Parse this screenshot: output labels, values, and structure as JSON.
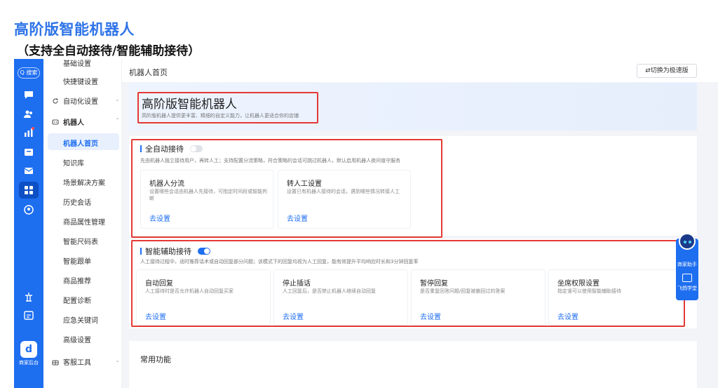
{
  "heading": {
    "main": "高阶版智能机器人",
    "sub": "（支持全自动接待/智能辅助接待）"
  },
  "rail": {
    "search": "Q 搜索",
    "brand_label": "商家后台",
    "brand_glyph": "d",
    "icons": [
      "chat-icon",
      "users-icon",
      "chart-icon",
      "box-icon",
      "mail-icon",
      "apps-icon",
      "user-icon",
      "settings-icon",
      "calendar-icon"
    ]
  },
  "menu": {
    "items_top": [
      "基础设置",
      "快捷键设置"
    ],
    "group_automation": "自动化设置",
    "group_robot": "机器人",
    "robot_items": [
      "机器人首页",
      "知识库",
      "场景解决方案",
      "历史会话",
      "商品属性管理",
      "智能尺码表",
      "智能跟单",
      "商品推荐",
      "配置诊断",
      "应急关键词",
      "高级设置"
    ],
    "group_tools": "客服工具"
  },
  "topbar": {
    "title": "机器人首页",
    "switch_label": "⇄切换为极速版"
  },
  "banner": {
    "title": "高阶版智能机器人",
    "desc": "高阶版机器人提供更丰富、精细的自定义能力，让机器人更适合你的店铺"
  },
  "auto": {
    "title": "全自动接待",
    "enabled": false,
    "desc": "先由机器人独立接待用户，再转人工；支持配置分流策略，符合策略的会话可跳过机器人，默认启用机器人夜间值守服务",
    "cards": [
      {
        "title": "机器人分流",
        "desc": "设置哪些会话由机器人先接待，可指定时间段或智能判断",
        "link": "去设置"
      },
      {
        "title": "转人工设置",
        "desc": "设置已有机器人接待的会话，遇到哪些情况转接人工",
        "link": "去设置"
      }
    ]
  },
  "assist": {
    "title": "智能辅助接待",
    "enabled": true,
    "desc": "人工接待过程中，适时推荐话术或自动回复部分问题；该模式下的回复均视为人工回复，能有效提升平均响应时长和3分钟回复率",
    "cards": [
      {
        "title": "自动回复",
        "desc": "人工接待时是否允许机器人自动回复买家",
        "link": "去设置"
      },
      {
        "title": "停止插话",
        "desc": "人工回复后，是否禁止机器人继续自动回复",
        "link": "去设置"
      },
      {
        "title": "暂停回复",
        "desc": "是否重复回答问题/回复被删回过的答案",
        "link": "去设置"
      },
      {
        "title": "坐席权限设置",
        "desc": "指定谁可以使用智能辅助接待",
        "link": "去设置"
      }
    ]
  },
  "common": {
    "title": "常用功能"
  },
  "float": {
    "assistant": "商家助手",
    "study": "飞鸽学堂"
  },
  "colors": {
    "accent": "#1e6ef0",
    "heading": "#2f74e8",
    "highlight": "#e53935"
  }
}
